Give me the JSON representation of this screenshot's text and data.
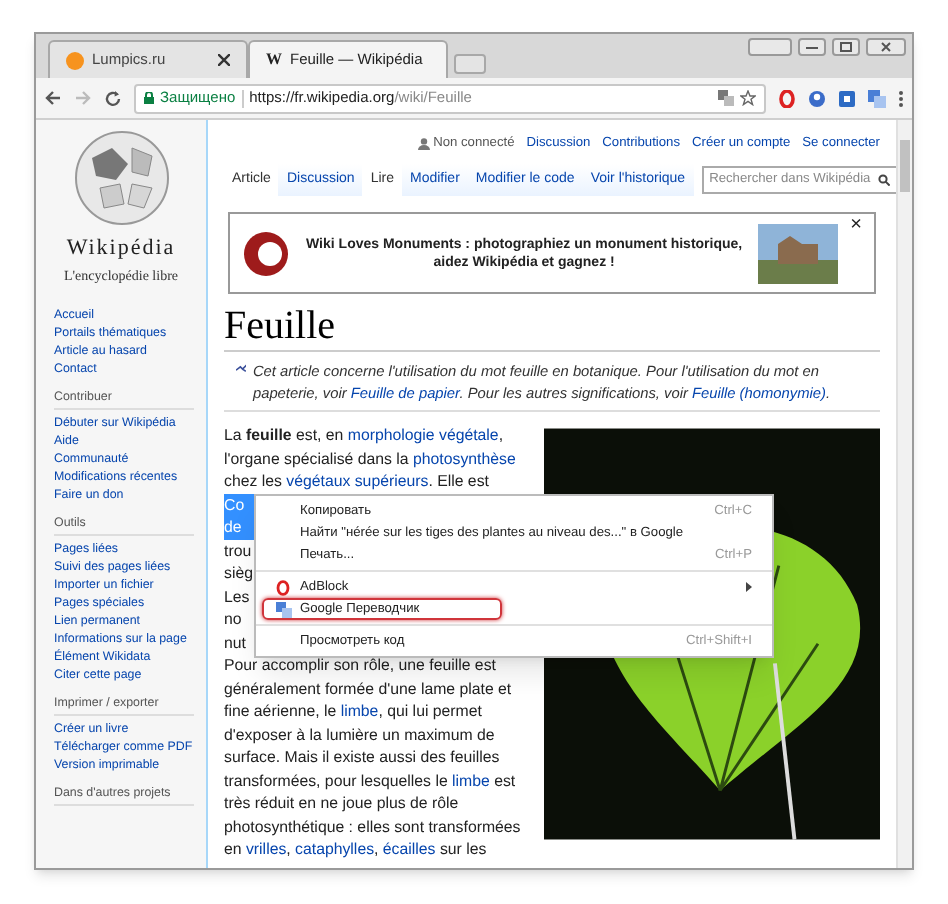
{
  "browser": {
    "tabs": [
      {
        "title": "Lumpics.ru",
        "selected": false
      },
      {
        "title": "Feuille — Wikipédia",
        "favicon": "W",
        "selected": true
      }
    ],
    "address": {
      "security": "Защищено",
      "url_host": "https://fr.wikipedia.org",
      "url_path": "/wiki/Feuille"
    }
  },
  "wiki": {
    "logo_title": "Wikipédia",
    "logo_subtitle": "L'encyclopédie libre",
    "sidebar": [
      {
        "links": [
          "Accueil",
          "Portails thématiques",
          "Article au hasard",
          "Contact"
        ]
      },
      {
        "heading": "Contribuer",
        "links": [
          "Débuter sur Wikipédia",
          "Aide",
          "Communauté",
          "Modifications récentes",
          "Faire un don"
        ]
      },
      {
        "heading": "Outils",
        "links": [
          "Pages liées",
          "Suivi des pages liées",
          "Importer un fichier",
          "Pages spéciales",
          "Lien permanent",
          "Informations sur la page",
          "Élément Wikidata",
          "Citer cette page"
        ]
      },
      {
        "heading": "Imprimer / exporter",
        "links": [
          "Créer un livre",
          "Télécharger comme PDF",
          "Version imprimable"
        ]
      },
      {
        "heading": "Dans d'autres projets"
      }
    ],
    "personal": [
      "Non connecté",
      "Discussion",
      "Contributions",
      "Créer un compte",
      "Se connecter"
    ],
    "namespace_tabs": [
      {
        "label": "Article",
        "selected": true
      },
      {
        "label": "Discussion",
        "selected": false
      }
    ],
    "view_tabs": [
      {
        "label": "Lire",
        "selected": true
      },
      {
        "label": "Modifier",
        "selected": false
      },
      {
        "label": "Modifier le code",
        "selected": false
      },
      {
        "label": "Voir l'historique",
        "selected": false
      }
    ],
    "search": {
      "placeholder": "Rechercher dans Wikipédia"
    },
    "banner": {
      "text": "Wiki Loves Monuments : photographiez un monument historique, aidez Wikipédia et gagnez !",
      "close": "×"
    },
    "title": "Feuille",
    "hatnote": [
      {
        "kind": "text",
        "text": "Cet article concerne l'utilisation du mot feuille en botanique. Pour l'utilisation du mot en papeterie, voir "
      },
      {
        "kind": "link",
        "text": "Feuille de papier"
      },
      {
        "kind": "text",
        "text": ". Pour les autres significations, voir "
      },
      {
        "kind": "link",
        "text": "Feuille (homonymie)"
      },
      {
        "kind": "text",
        "text": "."
      }
    ],
    "paragraph": [
      {
        "selected": false,
        "parts": [
          {
            "kind": "text",
            "text": "La "
          },
          {
            "kind": "bold",
            "text": "feuille"
          },
          {
            "kind": "text",
            "text": " est, en "
          },
          {
            "kind": "link",
            "text": "morphologie végétale"
          },
          {
            "kind": "text",
            "text": ","
          }
        ]
      },
      {
        "selected": false,
        "parts": [
          {
            "kind": "text",
            "text": "l'organe spécialisé dans la "
          },
          {
            "kind": "link",
            "text": "photosynthèse"
          }
        ]
      },
      {
        "selected": false,
        "parts": [
          {
            "kind": "text",
            "text": "chez les "
          },
          {
            "kind": "link",
            "text": "végétaux supérieurs"
          },
          {
            "kind": "text",
            "text": ". Elle est"
          }
        ]
      },
      {
        "selected": true,
        "parts": [
          {
            "kind": "text",
            "text": "Co"
          }
        ]
      },
      {
        "selected": true,
        "parts": [
          {
            "kind": "text",
            "text": "de"
          }
        ]
      },
      {
        "selected": false,
        "parts": [
          {
            "kind": "text",
            "text": "trou"
          }
        ]
      },
      {
        "selected": false,
        "parts": [
          {
            "kind": "text",
            "text": "sièg"
          }
        ]
      },
      {
        "selected": false,
        "parts": [
          {
            "kind": "text",
            "text": "Les"
          }
        ]
      },
      {
        "selected": false,
        "parts": [
          {
            "kind": "text",
            "text": "no"
          }
        ]
      },
      {
        "selected": false,
        "parts": [
          {
            "kind": "text",
            "text": "nut"
          }
        ]
      },
      {
        "selected": false,
        "parts": [
          {
            "kind": "text",
            "text": "Pour accomplir son rôle, une feuille est"
          }
        ]
      },
      {
        "selected": false,
        "parts": [
          {
            "kind": "text",
            "text": "généralement formée d'une lame plate et"
          }
        ]
      },
      {
        "selected": false,
        "parts": [
          {
            "kind": "text",
            "text": "fine aérienne, le "
          },
          {
            "kind": "link",
            "text": "limbe"
          },
          {
            "kind": "text",
            "text": ", qui lui permet"
          }
        ]
      },
      {
        "selected": false,
        "parts": [
          {
            "kind": "text",
            "text": "d'exposer à la lumière un maximum de"
          }
        ]
      },
      {
        "selected": false,
        "parts": [
          {
            "kind": "text",
            "text": "surface. Mais il existe aussi des feuilles"
          }
        ]
      },
      {
        "selected": false,
        "parts": [
          {
            "kind": "text",
            "text": "transformées, pour lesquelles le "
          },
          {
            "kind": "link",
            "text": "limbe"
          },
          {
            "kind": "text",
            "text": " est"
          }
        ]
      },
      {
        "selected": false,
        "parts": [
          {
            "kind": "text",
            "text": "très réduit en ne joue plus de rôle"
          }
        ]
      },
      {
        "selected": false,
        "parts": [
          {
            "kind": "text",
            "text": "photosynthétique : elles sont transformées"
          }
        ]
      },
      {
        "selected": false,
        "parts": [
          {
            "kind": "text",
            "text": "en "
          },
          {
            "kind": "link",
            "text": "vrilles"
          },
          {
            "kind": "text",
            "text": ", "
          },
          {
            "kind": "link",
            "text": "cataphylles"
          },
          {
            "kind": "text",
            "text": ", "
          },
          {
            "kind": "link",
            "text": "écailles"
          },
          {
            "kind": "text",
            "text": " sur les"
          }
        ]
      }
    ]
  },
  "context_menu": [
    {
      "kind": "item",
      "label": "Копировать",
      "shortcut": "Ctrl+C",
      "highlighted": false
    },
    {
      "kind": "item",
      "label": "Найти \"нéréе sur les tiges des plantes au niveau des...\" в Google",
      "highlighted": false
    },
    {
      "kind": "item",
      "label": "Печать...",
      "shortcut": "Ctrl+P",
      "highlighted": false
    },
    {
      "kind": "separator"
    },
    {
      "kind": "submenu",
      "label": "AdBlock",
      "highlighted": false
    },
    {
      "kind": "extension",
      "label": "Google Переводчик",
      "highlighted": true
    },
    {
      "kind": "separator"
    },
    {
      "kind": "item",
      "label": "Просмотреть код",
      "shortcut": "Ctrl+Shift+I",
      "highlighted": false
    }
  ]
}
